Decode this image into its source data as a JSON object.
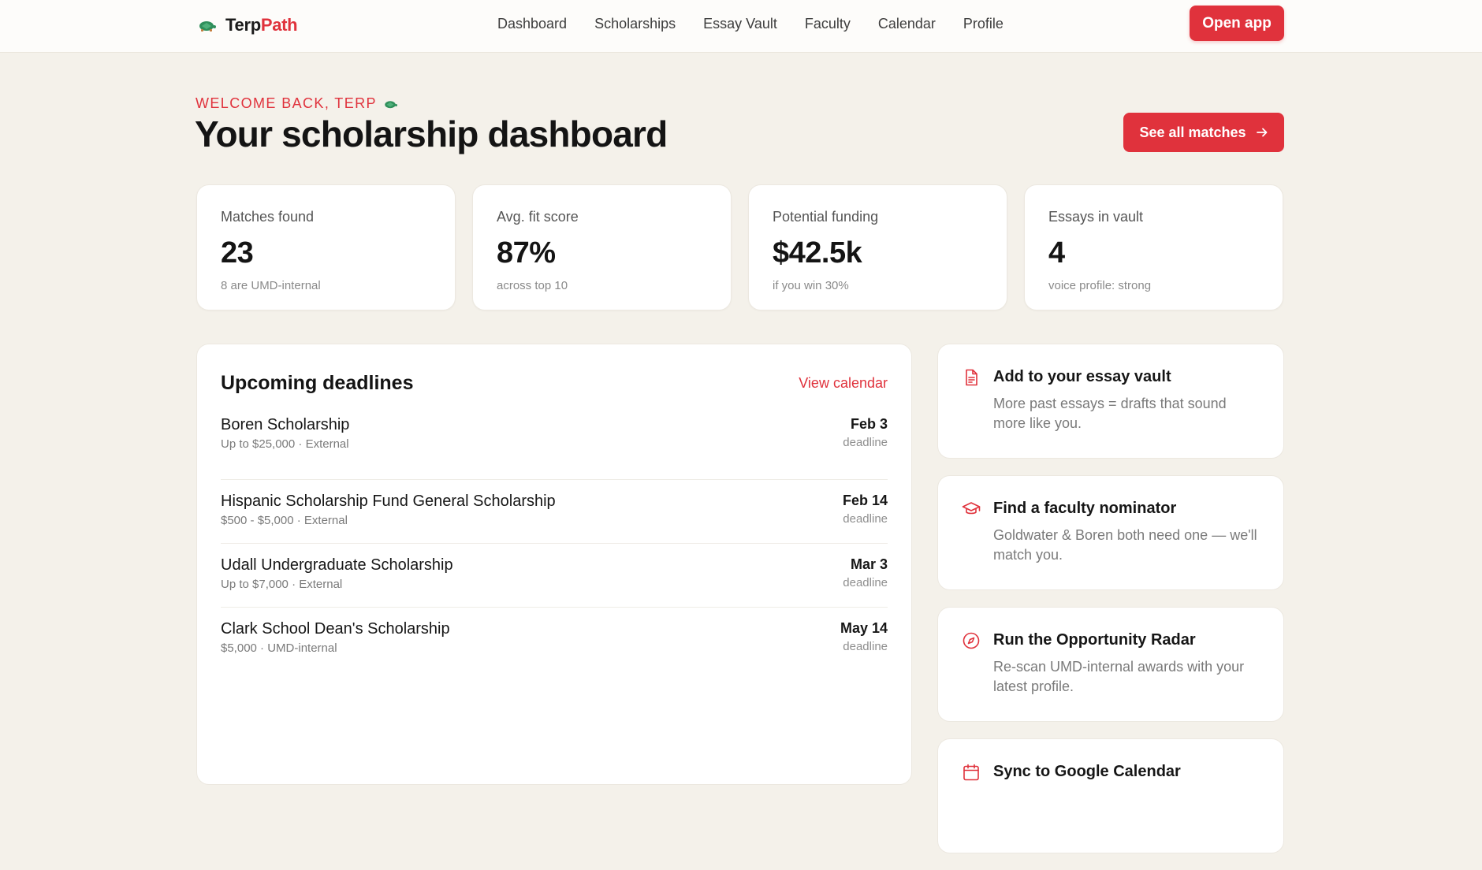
{
  "brand": {
    "name_part1": "Terp",
    "name_part2": "Path"
  },
  "nav": {
    "items": [
      "Dashboard",
      "Scholarships",
      "Essay Vault",
      "Faculty",
      "Calendar",
      "Profile"
    ],
    "open_app_label": "Open app"
  },
  "hero": {
    "welcome": "WELCOME BACK, TERP",
    "title": "Your scholarship dashboard",
    "see_all_label": "See all matches"
  },
  "stats": [
    {
      "label": "Matches found",
      "value": "23",
      "sub": "8 are UMD-internal"
    },
    {
      "label": "Avg. fit score",
      "value": "87%",
      "sub": "across top 10"
    },
    {
      "label": "Potential funding",
      "value": "$42.5k",
      "sub": "if you win 30%"
    },
    {
      "label": "Essays in vault",
      "value": "4",
      "sub": "voice profile: strong"
    }
  ],
  "deadlines": {
    "title": "Upcoming deadlines",
    "view_calendar_label": "View calendar",
    "items": [
      {
        "name": "Boren Scholarship",
        "meta": "Up to $25,000 · External",
        "date": "Feb 3",
        "tag": "deadline"
      },
      {
        "name": "Hispanic Scholarship Fund General Scholarship",
        "meta": "$500 - $5,000 · External",
        "date": "Feb 14",
        "tag": "deadline"
      },
      {
        "name": "Udall Undergraduate Scholarship",
        "meta": "Up to $7,000 · External",
        "date": "Mar 3",
        "tag": "deadline"
      },
      {
        "name": "Clark School Dean's Scholarship",
        "meta": "$5,000 · UMD-internal",
        "date": "May 14",
        "tag": "deadline"
      }
    ]
  },
  "actions": [
    {
      "icon": "document-icon",
      "title": "Add to your essay vault",
      "desc": "More past essays = drafts that sound more like you."
    },
    {
      "icon": "graduation-cap-icon",
      "title": "Find a faculty nominator",
      "desc": "Goldwater & Boren both need one — we'll match you."
    },
    {
      "icon": "compass-icon",
      "title": "Run the Opportunity Radar",
      "desc": "Re-scan UMD-internal awards with your latest profile."
    },
    {
      "icon": "calendar-icon",
      "title": "Sync to Google Calendar",
      "desc": ""
    }
  ],
  "colors": {
    "accent": "#e0323c",
    "background": "#f4f1ea",
    "card": "#ffffff",
    "turtle_green": "#2f8f5b"
  }
}
